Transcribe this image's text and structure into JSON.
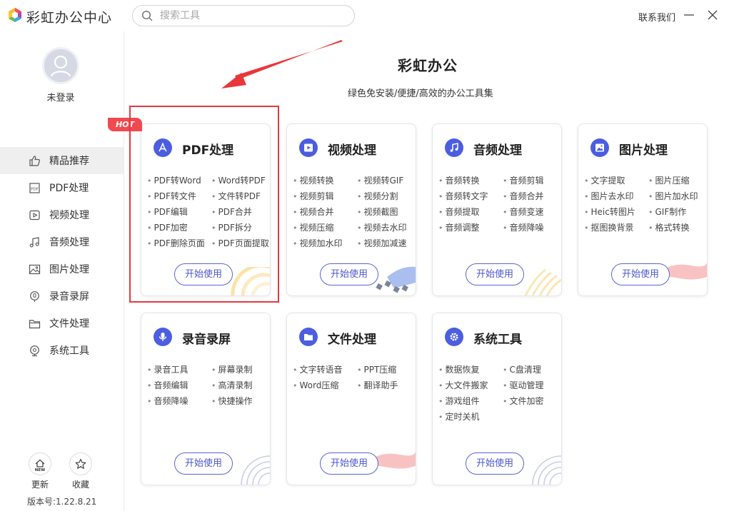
{
  "app": {
    "title": "彩虹办公中心",
    "contact": "联系我们"
  },
  "search": {
    "placeholder": "搜索工具"
  },
  "user": {
    "status": "未登录"
  },
  "sidebar": {
    "items": [
      {
        "label": "精品推荐",
        "icon": "thumbs-up-icon",
        "active": true
      },
      {
        "label": "PDF处理",
        "icon": "pdf-icon"
      },
      {
        "label": "视频处理",
        "icon": "video-icon"
      },
      {
        "label": "音频处理",
        "icon": "music-icon"
      },
      {
        "label": "图片处理",
        "icon": "image-icon"
      },
      {
        "label": "录音录屏",
        "icon": "record-icon"
      },
      {
        "label": "文件处理",
        "icon": "folder-icon"
      },
      {
        "label": "系统工具",
        "icon": "system-icon"
      }
    ],
    "update_label": "更新",
    "update_badge": "NEW",
    "favorite_label": "收藏",
    "version": "版本号:1.22.8.21"
  },
  "main": {
    "title": "彩虹办公",
    "subtitle": "绿色免安装/便捷/高效的办公工具集"
  },
  "hot_badge": "HOT",
  "start_label": "开始使用",
  "colors": {
    "accent": "#4b5ee0",
    "highlight": "#e8373c",
    "hot": "#f0494f"
  },
  "cards": [
    {
      "title": "PDF处理",
      "icon": "pdf-acrobat-icon",
      "tools": [
        "PDF转Word",
        "Word转PDF",
        "PDF转文件",
        "文件转PDF",
        "PDF编辑",
        "PDF合并",
        "PDF加密",
        "PDF拆分",
        "PDF删除页面",
        "PDF页面提取"
      ]
    },
    {
      "title": "视频处理",
      "icon": "play-icon",
      "tools": [
        "视频转换",
        "视频转GIF",
        "视频剪辑",
        "视频分割",
        "视频合并",
        "视频截图",
        "视频压缩",
        "视频去水印",
        "视频加水印",
        "视频加减速"
      ]
    },
    {
      "title": "音频处理",
      "icon": "music-note-icon",
      "tools": [
        "音频转换",
        "音频剪辑",
        "音频转文字",
        "音频合并",
        "音频提取",
        "音频变速",
        "音频调整",
        "音频降噪"
      ]
    },
    {
      "title": "图片处理",
      "icon": "picture-icon",
      "tools": [
        "文字提取",
        "图片压缩",
        "图片去水印",
        "图片加水印",
        "Heic转图片",
        "GIF制作",
        "抠图换背景",
        "格式转换"
      ]
    },
    {
      "title": "录音录屏",
      "icon": "microphone-icon",
      "tools": [
        "录音工具",
        "屏幕录制",
        "音频编辑",
        "高清录制",
        "音频降噪",
        "快捷操作"
      ]
    },
    {
      "title": "文件处理",
      "icon": "folder-open-icon",
      "tools": [
        "文字转语音",
        "PPT压缩",
        "Word压缩",
        "翻译助手"
      ]
    },
    {
      "title": "系统工具",
      "icon": "gear-icon",
      "tools": [
        "数据恢复",
        "C盘清理",
        "大文件搬家",
        "驱动管理",
        "游戏组件",
        "文件加密",
        "定时关机"
      ]
    }
  ]
}
